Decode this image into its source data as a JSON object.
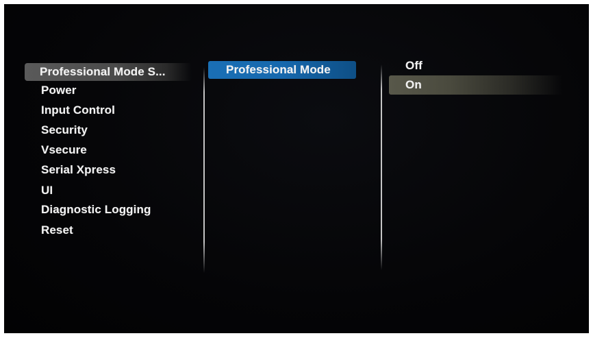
{
  "menu": {
    "column1": {
      "selected_label": "Professional Mode S...",
      "items": [
        {
          "label": "Power"
        },
        {
          "label": "Input Control"
        },
        {
          "label": "Security"
        },
        {
          "label": "Vsecure"
        },
        {
          "label": "Serial Xpress"
        },
        {
          "label": "UI"
        },
        {
          "label": "Diagnostic Logging"
        },
        {
          "label": "Reset"
        }
      ]
    },
    "column2": {
      "active_label": "Professional Mode"
    },
    "column3": {
      "options": [
        {
          "label": "Off"
        },
        {
          "label": "On"
        }
      ],
      "selected_option": "On"
    }
  },
  "colors": {
    "background": "#050507",
    "active_blue": "#1a6fb5",
    "selected_gray": "#5a5a5a",
    "text": "#f2f2f2"
  }
}
